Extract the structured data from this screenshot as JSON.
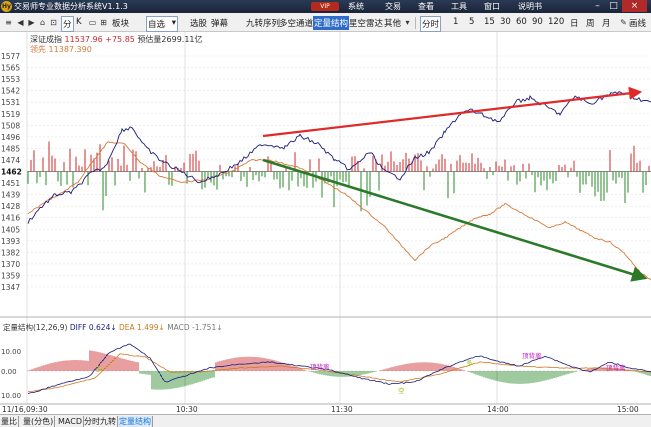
{
  "app": {
    "logo_text": "Hy",
    "title": "交易师专业数据分析系统V1.1.3",
    "vip": "VIP",
    "menu": [
      "系统",
      "交易",
      "查看",
      "工具",
      "窗口",
      "说明书"
    ]
  },
  "toolbar": {
    "items": [
      {
        "label": "分",
        "selected": true
      },
      {
        "label": "K",
        "selected": false
      },
      {
        "label": "板块",
        "selected": false
      },
      {
        "label": "自选",
        "selected": true
      },
      {
        "label": "选股",
        "selected": false
      },
      {
        "label": "弹幕",
        "selected": false
      },
      {
        "label": "九转序列",
        "selected": false
      },
      {
        "label": "多空通道",
        "selected": false
      },
      {
        "label": "定量结构",
        "selected": true
      },
      {
        "label": "星空雷达",
        "selected": false
      },
      {
        "label": "其他",
        "selected": false
      }
    ],
    "dropdown_arrow": "▾",
    "periods": [
      "分时",
      "1",
      "5",
      "15",
      "30",
      "60",
      "90",
      "120",
      "日",
      "周",
      "月"
    ],
    "active_period": "分时",
    "right_label": "画线"
  },
  "main_panel": {
    "index_name": "深证成指",
    "index_value": "11537.96",
    "index_change": "+75.85",
    "forecast_label": "预估量",
    "forecast_value": "2699.11亿",
    "lead_label": "领先",
    "lead_value": "11387.390",
    "y_ticks": [
      "1577",
      "1565",
      "1553",
      "1542",
      "1531",
      "1519",
      "1508",
      "1496",
      "1485",
      "1474",
      "1462",
      "1451",
      "1439",
      "1428",
      "1416",
      "1405",
      "1393",
      "1382",
      "1370",
      "1359",
      "1347"
    ],
    "baseline_label": "1462"
  },
  "indicator_panel": {
    "name": "定量结构(12,26,9)",
    "diff_label": "DIFF",
    "diff_value": "0.624",
    "diff_arrow": "↓",
    "dea_label": "DEA",
    "dea_value": "1.499",
    "dea_arrow": "↓",
    "macd_label": "MACD",
    "macd_value": "-1.751",
    "macd_arrow": "↓",
    "y_ticks": [
      "10.00",
      "0.00",
      "10.00"
    ],
    "annotations": [
      {
        "text": "多",
        "color": "#a0c020"
      },
      {
        "text": "顶背离",
        "color": "#cc22cc"
      },
      {
        "text": "多",
        "color": "#a0c020"
      },
      {
        "text": "顶背离",
        "color": "#cc22cc"
      },
      {
        "text": "空",
        "color": "#a0c020"
      },
      {
        "text": "顶背离",
        "color": "#cc22cc"
      }
    ]
  },
  "time_axis": [
    "11/16,09:30",
    "10:30",
    "11:30",
    "14:00",
    "15:00"
  ],
  "bottom_tabs": [
    {
      "label": "量比",
      "active": false
    },
    {
      "label": "量(分色)",
      "active": false
    },
    {
      "label": "MACD",
      "active": false
    },
    {
      "label": "分时九转",
      "active": false
    },
    {
      "label": "定量结构",
      "active": true
    }
  ],
  "colors": {
    "index_line": "#1a1a7a",
    "lead_line": "#d87a3a",
    "up_bar": "#cc2a2a",
    "down_bar": "#2a8a2a",
    "red_arrow": "#e02a2a",
    "green_arrow": "#2a7a2a",
    "dea_line": "#cc7a22",
    "diff_line": "#1a1a7a",
    "accent": "#2f6cc9"
  }
}
